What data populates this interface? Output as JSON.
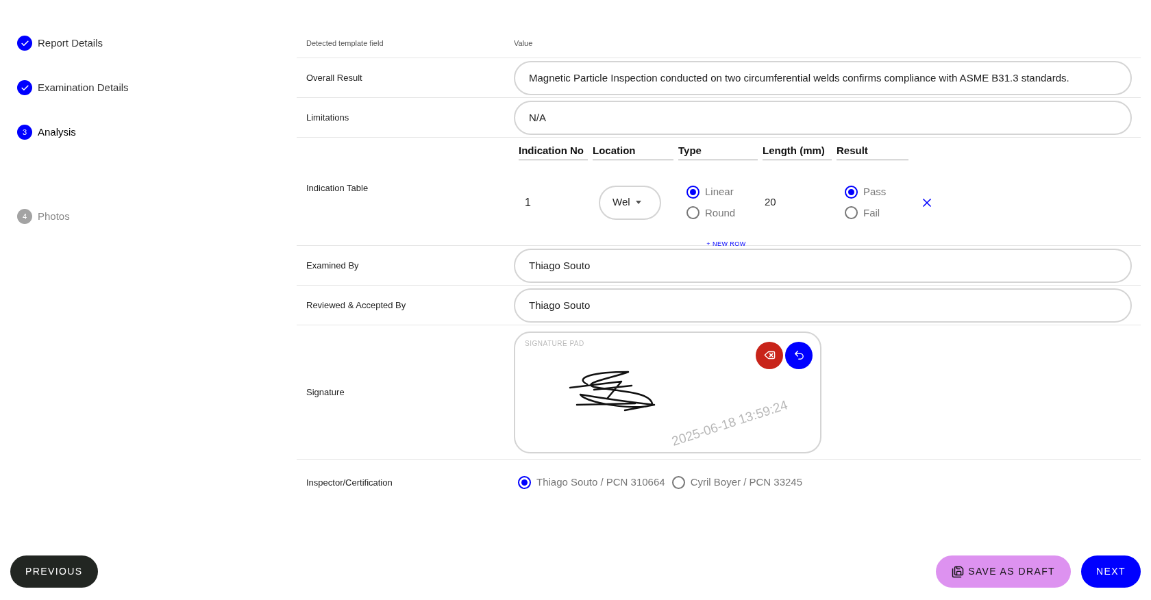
{
  "steps": [
    {
      "label": "Report Details",
      "kind": "done"
    },
    {
      "label": "Examination Details",
      "kind": "done"
    },
    {
      "label": "Analysis",
      "kind": "current",
      "number": "3"
    },
    {
      "label": "Photos",
      "kind": "upcoming",
      "number": "4"
    }
  ],
  "table": {
    "columns": [
      "Detected template field",
      "Value"
    ],
    "rows": [
      {
        "kind": "text",
        "label": "Overall Result",
        "value": "Magnetic Particle Inspection conducted on two circumferential welds confirms compliance with ASME B31.3 standards."
      },
      {
        "kind": "text",
        "label": "Limitations",
        "value": "N/A"
      },
      {
        "kind": "indications",
        "label": "Indication Table",
        "columns": [
          "Indication No",
          "Location",
          "Type",
          "Length (mm)",
          "Result"
        ],
        "rows": [
          {
            "number": "1",
            "location": "Wel",
            "type_options": [
              {
                "label": "Linear",
                "selected": true
              },
              {
                "label": "Round",
                "selected": false
              }
            ],
            "length": "20",
            "result_options": [
              {
                "label": "Pass",
                "selected": true
              },
              {
                "label": "Fail",
                "selected": false
              }
            ]
          }
        ],
        "add_label": "+ NEW ROW"
      },
      {
        "kind": "text",
        "label": "Examined By",
        "value": "Thiago Souto"
      },
      {
        "kind": "text",
        "label": "Reviewed & Accepted By",
        "value": "Thiago Souto"
      },
      {
        "kind": "signature",
        "label": "Signature",
        "pad_label": "SIGNATURE PAD",
        "watermark": "2025-06-18 13:59:24"
      },
      {
        "kind": "choice",
        "label": "Inspector/Certification",
        "options": [
          {
            "label": "Thiago Souto / PCN 310664",
            "selected": true
          },
          {
            "label": "Cyril Boyer / PCN 33245",
            "selected": false
          }
        ]
      }
    ]
  },
  "footer": {
    "previous": "PREVIOUS",
    "save_draft": "SAVE AS DRAFT",
    "next": "NEXT"
  }
}
